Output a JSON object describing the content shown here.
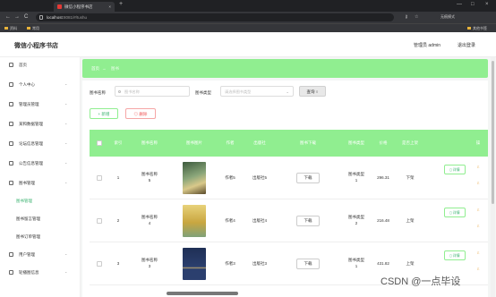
{
  "browser": {
    "tab_title": "微信小程序书店",
    "tab_close": "×",
    "new_tab": "+",
    "url_host": "localhost",
    "url_path": ":8081/#/tushu",
    "bookmarks": [
      "资料",
      "常用"
    ],
    "bookmark_right": "其他书签",
    "profile_label": "无痕模式",
    "window_controls": [
      "—",
      "□",
      "×"
    ],
    "nav_icons": [
      "←",
      "→",
      "C"
    ],
    "right_icons": [
      "⚷",
      "☆"
    ]
  },
  "header": {
    "app_title": "微信小程序书店",
    "user_label": "管理员 admin",
    "logout_label": "退出登录"
  },
  "sidebar": {
    "items": [
      {
        "label": "首页",
        "icon": "home-icon",
        "has_chevron": false
      },
      {
        "label": "个人中心",
        "icon": "user-icon",
        "has_chevron": true
      },
      {
        "label": "管理员管理",
        "icon": "admin-icon",
        "has_chevron": true
      },
      {
        "label": "某和数据管理",
        "icon": "data-icon",
        "has_chevron": true
      },
      {
        "label": "论坛信息管理",
        "icon": "forum-icon",
        "has_chevron": true
      },
      {
        "label": "公告信息管理",
        "icon": "notice-icon",
        "has_chevron": true
      },
      {
        "label": "图书管理",
        "icon": "book-icon",
        "has_chevron": true
      }
    ],
    "sub_items": [
      "图书管理",
      "图书留言管理",
      "图书订单管理"
    ],
    "active_sub": "图书管理",
    "bottom_items": [
      {
        "label": "用户管理",
        "icon": "users-icon",
        "has_chevron": true
      },
      {
        "label": "轮播图信息",
        "icon": "carousel-icon",
        "has_chevron": true
      }
    ],
    "chevron": "⌄"
  },
  "breadcrumb": {
    "home": "首页",
    "separator": "→",
    "current": "图书"
  },
  "filters": {
    "name_label": "图书名称",
    "name_placeholder": "图书名称",
    "type_label": "图书类型",
    "type_placeholder": "请选择图书类型",
    "search_label": "查询 ○",
    "dropdown_icon": "⌄"
  },
  "actions": {
    "add_label": "+ 新增",
    "delete_label": "◎ 删除"
  },
  "table": {
    "headers": [
      "",
      "索引",
      "图书名称",
      "图书图片",
      "作者",
      "出版社",
      "图书下载",
      "图书类型",
      "价格",
      "是否上架",
      "操"
    ],
    "rows": [
      {
        "index": "1",
        "name": "图书名称\n5",
        "author": "作者5",
        "publisher": "出版社5",
        "download": "下载",
        "type": "图书类型\n1",
        "price": "296.31",
        "status": "下架",
        "detail": "▯ 详情",
        "edge": "ℰ",
        "cover_color": "#6b8e6b"
      },
      {
        "index": "2",
        "name": "图书名称\n4",
        "author": "作者4",
        "publisher": "出版社4",
        "download": "下载",
        "type": "图书类型\n2",
        "price": "216.48",
        "status": "上架",
        "detail": "▯ 详情",
        "edge": "ℰ",
        "cover_color": "#c9a640"
      },
      {
        "index": "3",
        "name": "图书名称\n3",
        "author": "作者3",
        "publisher": "出版社3",
        "download": "下载",
        "type": "图书类型\n1",
        "price": "431.82",
        "status": "上架",
        "detail": "▯ 详情",
        "edge": "ℰ",
        "cover_color": "#2b3f6e"
      }
    ]
  },
  "watermark": "CSDN @一点毕设"
}
